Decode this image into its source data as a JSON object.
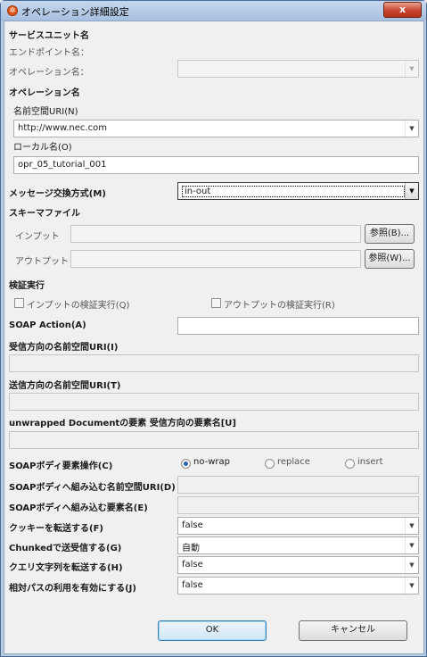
{
  "window": {
    "title": "オペレーション詳細設定",
    "close_label": "x"
  },
  "service_unit": {
    "heading": "サービスユニット名",
    "endpoint_label": "エンドポイント名：",
    "operation_label": "オペレーション名：",
    "operation_value": ""
  },
  "operation": {
    "heading": "オペレーション名",
    "namespace_label": "名前空間URI(N)",
    "namespace_value": "http://www.nec.com",
    "local_label": "ローカル名(O)",
    "local_value": "opr_05_tutorial_001"
  },
  "message_exchange": {
    "label": "メッセージ交換方式(M)",
    "value": "in-out"
  },
  "schema_file": {
    "heading": "スキーマファイル",
    "input_label": "インプット",
    "input_value": "",
    "input_browse": "参照(B)...",
    "output_label": "アウトプット",
    "output_value": "",
    "output_browse": "参照(W)..."
  },
  "validation": {
    "heading": "検証実行",
    "input_check_label": "インプットの検証実行(Q)",
    "input_checked": false,
    "output_check_label": "アウトプットの検証実行(R)",
    "output_checked": false
  },
  "soap_action": {
    "label": "SOAP Action(A)",
    "value": ""
  },
  "receive_namespace": {
    "label": "受信方向の名前空間URI(I)",
    "value": ""
  },
  "send_namespace": {
    "label": "送信方向の名前空間URI(T)",
    "value": ""
  },
  "unwrapped": {
    "label": "unwrapped Documentの要素 受信方向の要素名[U]",
    "value": ""
  },
  "soap_body_op": {
    "label": "SOAPボディ要素操作(C)",
    "options": [
      "no-wrap",
      "replace",
      "insert"
    ],
    "selected": "no-wrap"
  },
  "soap_body_ns": {
    "label": "SOAPボディへ組み込む名前空間URI(D)",
    "value": ""
  },
  "soap_body_elem": {
    "label": "SOAPボディへ組み込む要素名(E)",
    "value": ""
  },
  "cookie": {
    "label": "クッキーを転送する(F)",
    "value": "false"
  },
  "chunked": {
    "label": "Chunkedで送受信する(G)",
    "value": "自動"
  },
  "query": {
    "label": "クエリ文字列を転送する(H)",
    "value": "false"
  },
  "relative_path": {
    "label": "相対パスの利用を有効にする(J)",
    "value": "false"
  },
  "buttons": {
    "ok": "OK",
    "cancel": "キャンセル"
  },
  "colors": {
    "title_bar": "#b7cbe3",
    "close_button": "#c8452d",
    "panel": "#f0f0f0",
    "radio_selected": "#2a63b8"
  },
  "icons": {
    "app": "app-icon",
    "dropdown": "chevron-down-icon",
    "close": "close-icon"
  }
}
